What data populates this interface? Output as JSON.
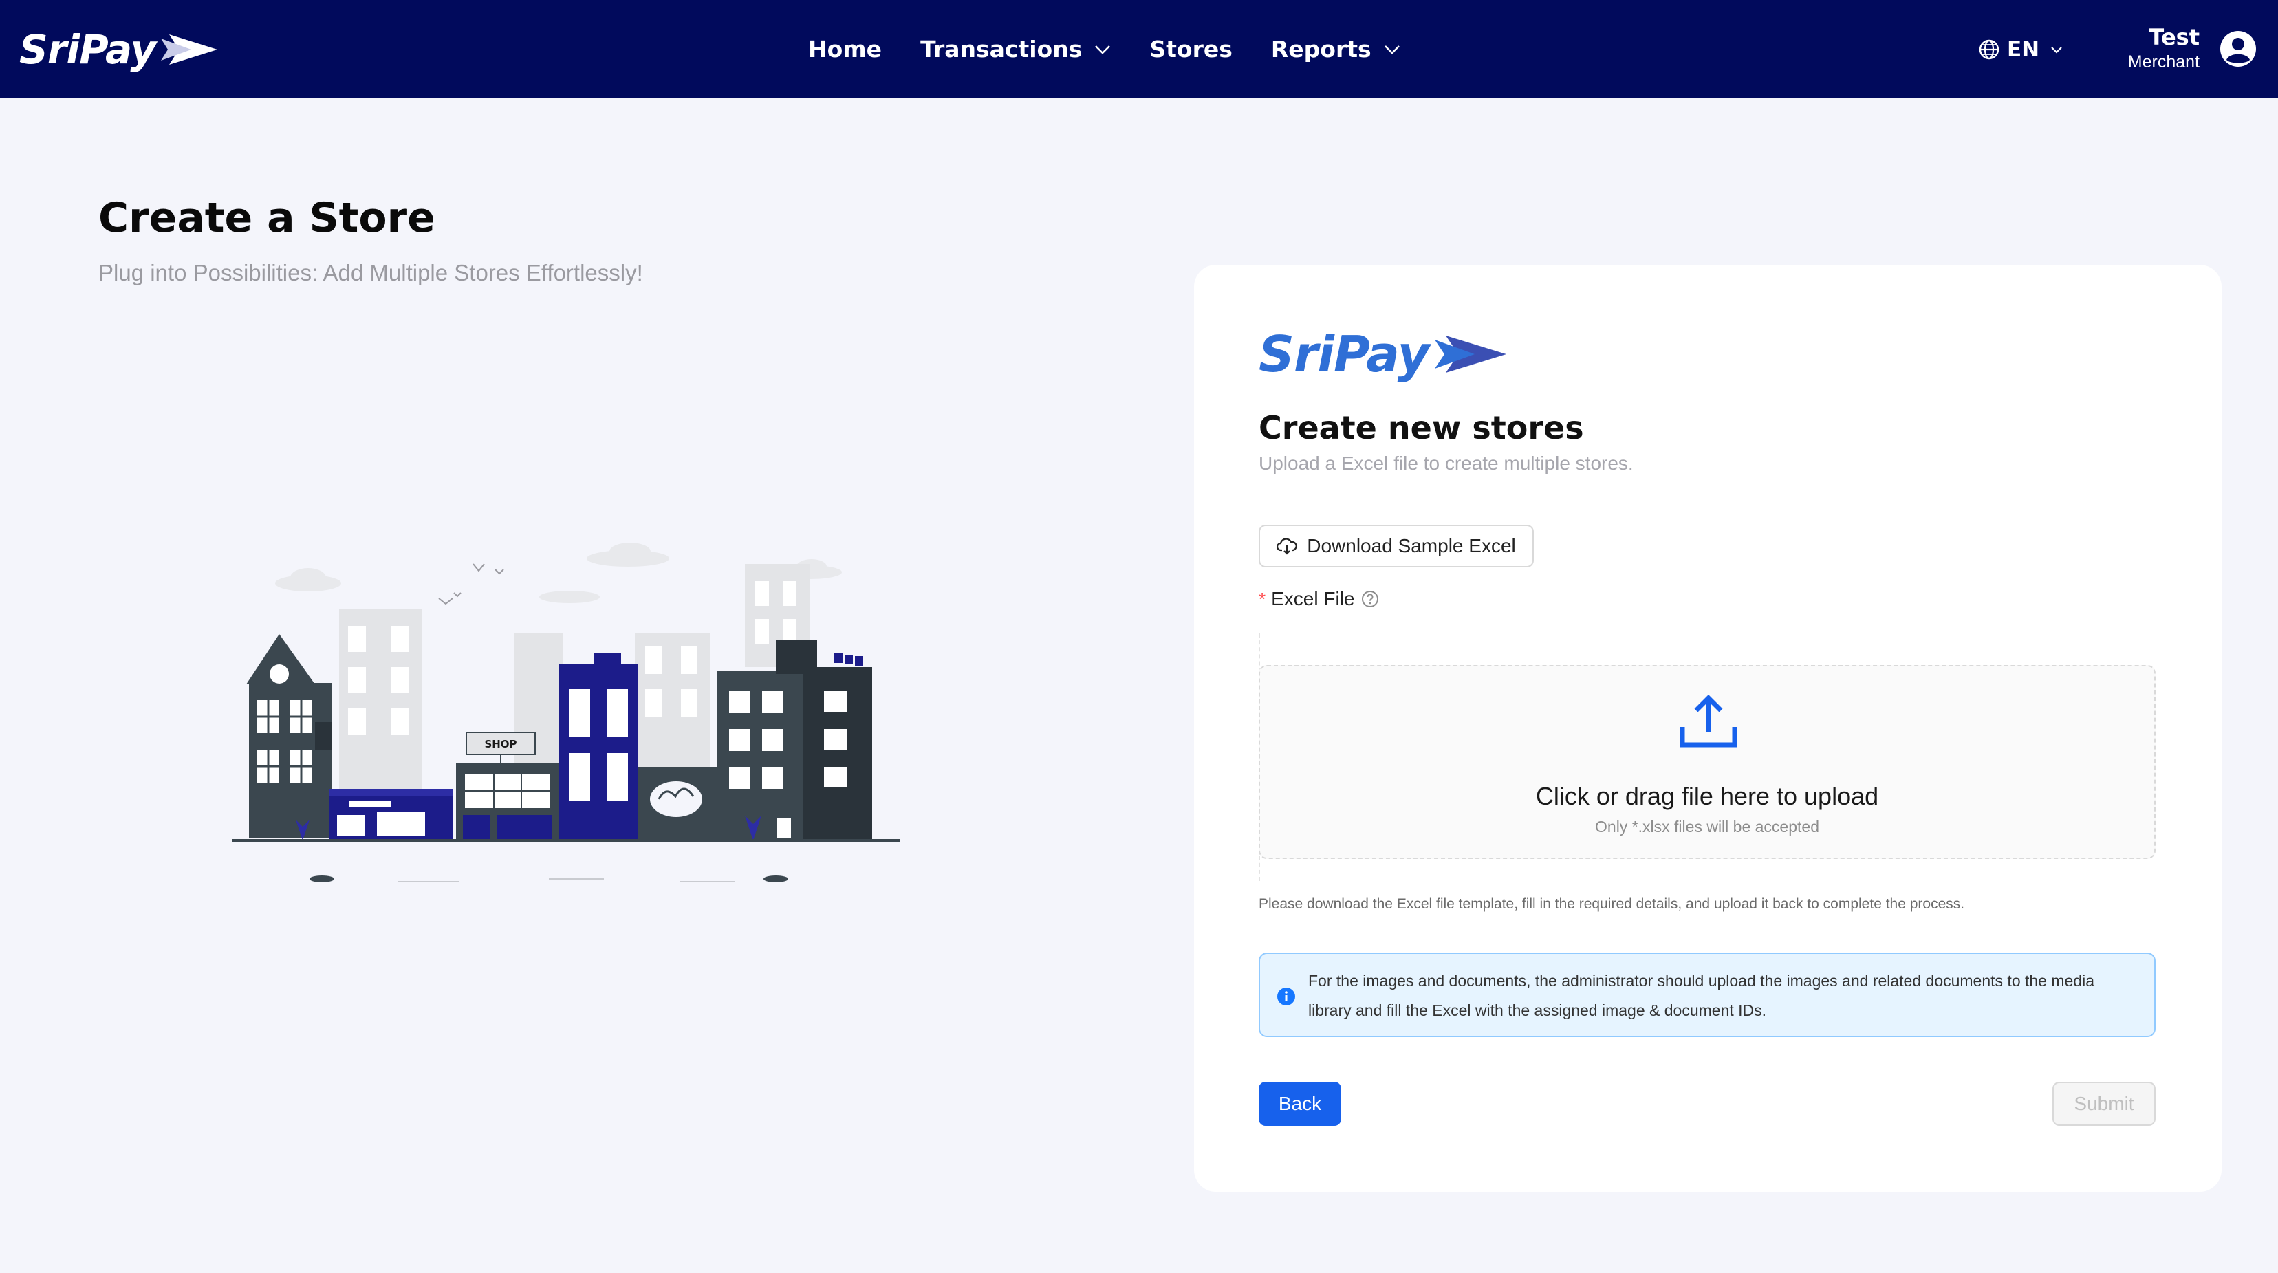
{
  "nav": {
    "brand": "SriPay",
    "items": [
      {
        "label": "Home",
        "dropdown": false
      },
      {
        "label": "Transactions",
        "dropdown": true
      },
      {
        "label": "Stores",
        "dropdown": false
      },
      {
        "label": "Reports",
        "dropdown": true
      }
    ],
    "language": "EN",
    "user": {
      "name": "Test",
      "role": "Merchant"
    }
  },
  "page": {
    "title": "Create a Store",
    "subtitle": "Plug into Possibilities: Add Multiple Stores Effortlessly!"
  },
  "illustration": {
    "shop_sign": "SHOP"
  },
  "card": {
    "brand": "SriPay",
    "title": "Create new stores",
    "subtitle": "Upload a Excel file to create multiple stores.",
    "download_button": "Download Sample Excel",
    "field_label": "Excel File",
    "required_mark": "*",
    "dropzone": {
      "title": "Click or drag file here to upload",
      "hint": "Only *.xlsx files will be accepted"
    },
    "help_text": "Please download the Excel file template, fill in the required details, and upload it back to complete the process.",
    "info": "For the images and documents, the administrator should upload the images and related documents to the media library and fill the Excel with the assigned image & document IDs.",
    "back_button": "Back",
    "submit_button": "Submit"
  },
  "colors": {
    "nav_bg": "#010a5c",
    "page_bg": "#f4f5fb",
    "primary": "#1761ec",
    "brand_blue": "#2f6fd6",
    "info_bg": "#e6f4ff",
    "info_border": "#91caff"
  },
  "icons": [
    "sripay-logo-arrow",
    "chevron-down-icon",
    "globe-icon",
    "user-avatar-icon",
    "cloud-download-icon",
    "question-circle-icon",
    "upload-icon",
    "info-icon"
  ]
}
